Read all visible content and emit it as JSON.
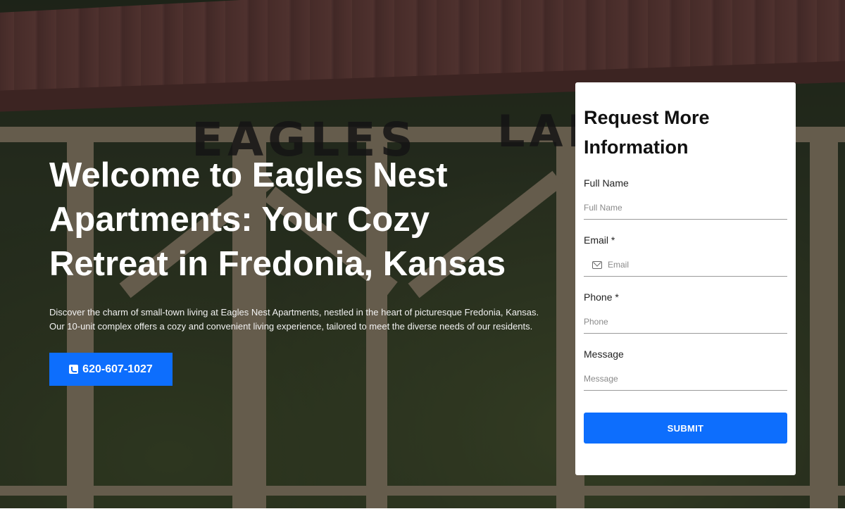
{
  "hero": {
    "sign_text_left": "EAGLES",
    "sign_text_right": "LAN",
    "headline": "Welcome to Eagles Nest Apartments: Your Cozy Retreat in Fredonia, Kansas",
    "lead": "Discover the charm of small-town living at Eagles Nest Apartments, nestled in the heart of picturesque Fredonia, Kansas. Our 10-unit complex offers a cozy and convenient living experience, tailored to meet the diverse needs of our residents.",
    "phone_label": "620-607-1027",
    "phone_icon": "phone-square-icon"
  },
  "form": {
    "title": "Request More Information",
    "full_name_label": "Full Name",
    "full_name_placeholder": "Full Name",
    "email_label": "Email *",
    "email_placeholder": "Email",
    "email_icon": "envelope-icon",
    "phone_label": "Phone *",
    "phone_placeholder": "Phone",
    "message_label": "Message",
    "message_placeholder": "Message",
    "submit_label": "SUBMIT"
  },
  "colors": {
    "accent": "#0d6efd",
    "overlay": "rgba(10,10,10,0.48)"
  }
}
